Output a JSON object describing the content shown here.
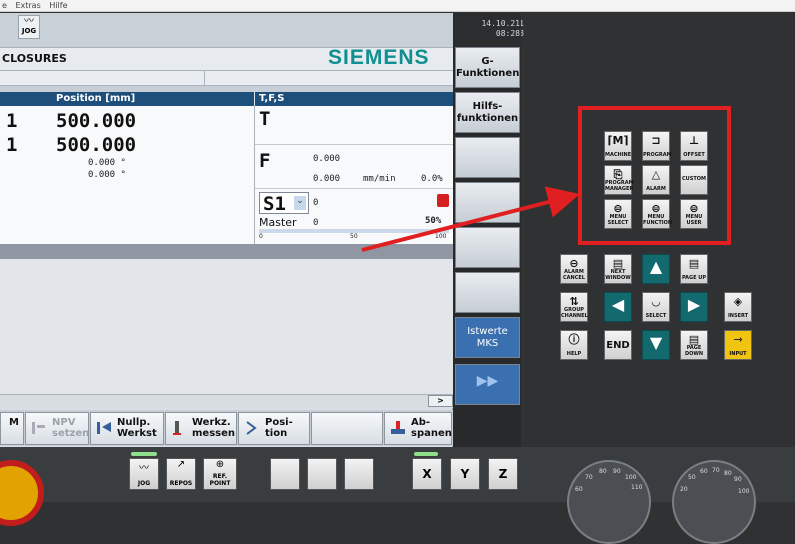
{
  "menubar": {
    "items": [
      "e",
      "Extras",
      "Hilfe"
    ]
  },
  "status": {
    "mode": "JOG",
    "date": "14.10.21",
    "time": "08:28"
  },
  "header": {
    "title": "CLOSURES",
    "brand": "SIEMENS"
  },
  "position": {
    "header": "Position [mm]",
    "rows": [
      {
        "axis": "1",
        "value": "500.000"
      },
      {
        "axis": "1",
        "value": "500.000"
      }
    ],
    "angles": [
      "0.000 °",
      "0.000 °"
    ]
  },
  "tfs": {
    "header": "T,F,S",
    "t_label": "T",
    "f_label": "F",
    "f_value1": "0.000",
    "f_value2": "0.000",
    "f_unit": "mm/min",
    "f_percent": "0.0%",
    "spindle": "S1",
    "s_value": "0",
    "master_label": "Master",
    "master_value": "0",
    "master_percent": "50%",
    "scale_0": "0",
    "scale_50": "50",
    "scale_100": "100"
  },
  "vertical_softkeys": [
    {
      "label": "G-\nFunktionen"
    },
    {
      "label": "Hilfs-\nfunktionen"
    },
    {
      "label": ""
    },
    {
      "label": ""
    },
    {
      "label": ""
    },
    {
      "label": ""
    },
    {
      "label": "Istwerte\nMKS"
    },
    {
      "label": "▶▶"
    }
  ],
  "horizontal_softkeys": [
    {
      "label": "M"
    },
    {
      "label": "NPV setzen"
    },
    {
      "label": "Nullp. Werkst"
    },
    {
      "label": "Werkz. messen"
    },
    {
      "label": "Posi- tion"
    },
    {
      "label": ""
    },
    {
      "label": "Ab- spanen"
    }
  ],
  "scrollbar": {
    "label": ">"
  },
  "panel_keys": {
    "machine": "MACHINE",
    "program": "PROGRAM",
    "offset": "OFFSET",
    "program_manager": "PROGRAM MANAGER",
    "alarm": "ALARM",
    "custom": "CUSTOM",
    "menu_select": "MENU SELECT",
    "menu_function": "MENU FUNCTION",
    "menu_user": "MENU USER",
    "alarm_cancel": "ALARM CANCEL",
    "next_window": "NEXT WINDOW",
    "page_up": "PAGE UP",
    "group_channel": "GROUP CHANNEL",
    "select": "SELECT",
    "insert": "INSERT",
    "help": "HELP",
    "end": "END",
    "page_down": "PAGE DOWN",
    "input": "INPUT"
  },
  "machine_keys": {
    "jog": "JOG",
    "repos": "REPOS",
    "ref_point": "REF. POINT",
    "x": "X",
    "y": "Y",
    "z": "Z"
  },
  "dial1": [
    "80",
    "90",
    "100",
    "110",
    "70",
    "60"
  ],
  "dial2": [
    "60",
    "70",
    "80",
    "90",
    "50",
    "100",
    "20"
  ],
  "colors": {
    "accent_red": "#e02020",
    "siemens_teal": "#0f8f8f"
  }
}
